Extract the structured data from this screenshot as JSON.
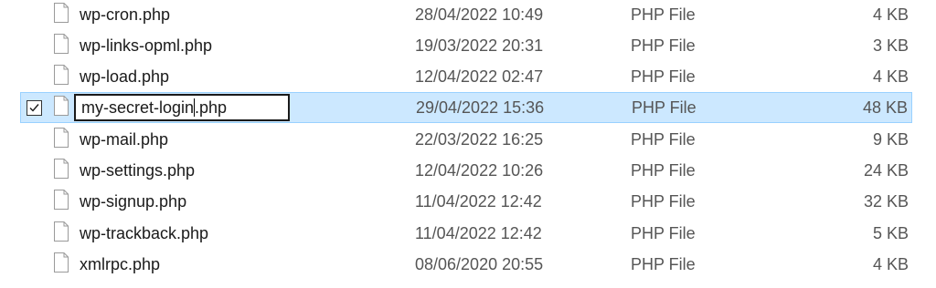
{
  "files": [
    {
      "name": "wp-cron.php",
      "modified": "28/04/2022 10:49",
      "type": "PHP File",
      "size": "4 KB"
    },
    {
      "name": "wp-links-opml.php",
      "modified": "19/03/2022 20:31",
      "type": "PHP File",
      "size": "3 KB"
    },
    {
      "name": "wp-load.php",
      "modified": "12/04/2022 02:47",
      "type": "PHP File",
      "size": "4 KB"
    },
    {
      "name": "my-secret-login.php",
      "modified": "29/04/2022 15:36",
      "type": "PHP File",
      "size": "48 KB",
      "selected": true,
      "checked": true,
      "rename_before_caret": "my-secret-login",
      "rename_after_caret": ".php"
    },
    {
      "name": "wp-mail.php",
      "modified": "22/03/2022 16:25",
      "type": "PHP File",
      "size": "9 KB"
    },
    {
      "name": "wp-settings.php",
      "modified": "12/04/2022 10:26",
      "type": "PHP File",
      "size": "24 KB"
    },
    {
      "name": "wp-signup.php",
      "modified": "11/04/2022 12:42",
      "type": "PHP File",
      "size": "32 KB"
    },
    {
      "name": "wp-trackback.php",
      "modified": "11/04/2022 12:42",
      "type": "PHP File",
      "size": "5 KB"
    },
    {
      "name": "xmlrpc.php",
      "modified": "08/06/2020 20:55",
      "type": "PHP File",
      "size": "4 KB"
    }
  ],
  "icons": {
    "file": "file-icon",
    "checkbox": "checkbox-checked-icon"
  },
  "colors": {
    "selection_background": "#cce8ff",
    "selection_border": "#99d1ff",
    "secondary_text": "#555555"
  }
}
